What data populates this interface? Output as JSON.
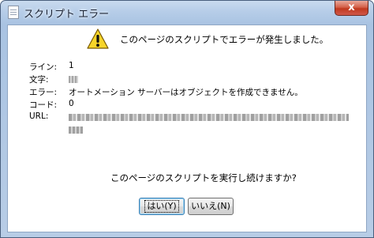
{
  "window": {
    "title": "スクリプト エラー",
    "close_label": "x"
  },
  "dialog": {
    "heading": "このページのスクリプトでエラーが発生しました。",
    "fields": {
      "line_label": "ライン:",
      "line_value": "1",
      "char_label": "文字:",
      "error_label": "エラー:",
      "error_value": "オートメーション サーバーはオブジェクトを作成できません。",
      "code_label": "コード:",
      "code_value": "0",
      "url_label": "URL:"
    },
    "question": "このページのスクリプトを実行し続けますか?",
    "buttons": {
      "yes": "はい(Y)",
      "no": "いいえ(N)"
    }
  },
  "icons": {
    "title": "document-icon",
    "warning": "warning-icon"
  },
  "colors": {
    "warning_fill": "#f7d52a",
    "close_button": "#c8432b"
  }
}
